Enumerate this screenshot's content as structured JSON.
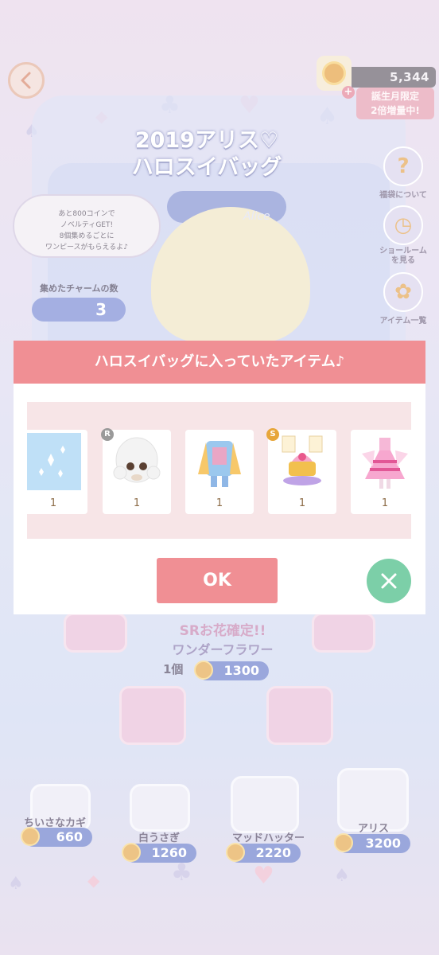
{
  "header": {
    "coins": "5,344",
    "birthday_tag_line1": "誕生月限定",
    "birthday_tag_line2": "2倍増量中!"
  },
  "title": {
    "line1": "2019アリス♡",
    "line2": "ハロスイバッグ"
  },
  "side_menu": [
    {
      "label": "福袋について",
      "icon": "question-icon"
    },
    {
      "label": "ショールーム\nを見る",
      "icon": "clock-icon"
    },
    {
      "label": "アイテム一覧",
      "icon": "bow-icon"
    }
  ],
  "speech": {
    "line1": "あと800コインで",
    "line2": "ノベルティGET!",
    "line3": "8個集めるごとに",
    "line4": "ワンピースがもらえるよ♪"
  },
  "charms": {
    "label": "集めたチャームの数",
    "count": "3"
  },
  "alice_logo": "Alice",
  "promo": {
    "line1": "SRお花確定!!",
    "line2": "ワンダーフラワー",
    "qty_label": "1個",
    "price": "1300"
  },
  "bags": [
    {
      "name": "ちいさなカギ",
      "price": "660"
    },
    {
      "name": "白うさぎ",
      "price": "1260"
    },
    {
      "name": "マッドハッター",
      "price": "2220"
    },
    {
      "name": "アリス",
      "price": "3200"
    }
  ],
  "dialog": {
    "title": "ハロスイバッグに入っていたアイテム♪",
    "ok_label": "OK",
    "items": [
      {
        "kind": "background",
        "qty": "1",
        "rarity": ""
      },
      {
        "kind": "ghost-hair",
        "qty": "1",
        "rarity": "R"
      },
      {
        "kind": "outfit",
        "qty": "1",
        "rarity": ""
      },
      {
        "kind": "tea-party-set",
        "qty": "1",
        "rarity": "S"
      },
      {
        "kind": "dress",
        "qty": "1",
        "rarity": ""
      }
    ]
  },
  "colors": {
    "accent": "#f08f94",
    "close": "#7ccfa8",
    "strip": "#f7e5e7",
    "pill": "#7486cf"
  }
}
